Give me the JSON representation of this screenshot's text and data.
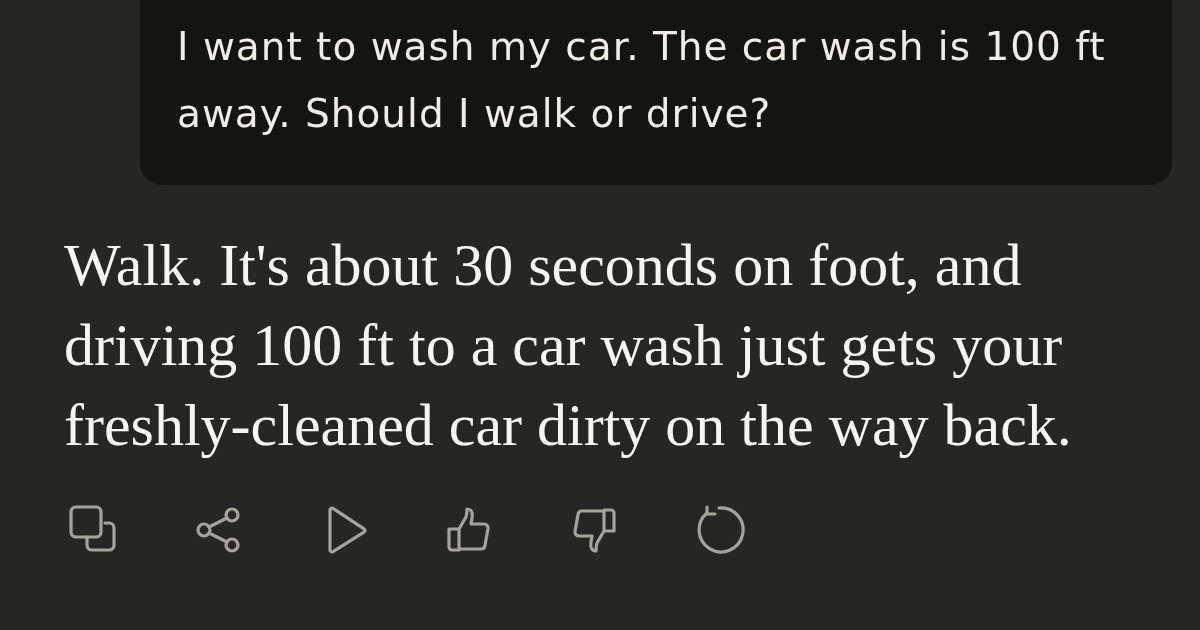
{
  "user_message": {
    "text": "I want to wash my car. The car wash is 100 ft away. Should I walk or drive?"
  },
  "assistant_message": {
    "text": "Walk. It's about 30 seconds on foot, and driving 100 ft to a car wash just gets your freshly-cleaned car dirty on the way back."
  }
}
